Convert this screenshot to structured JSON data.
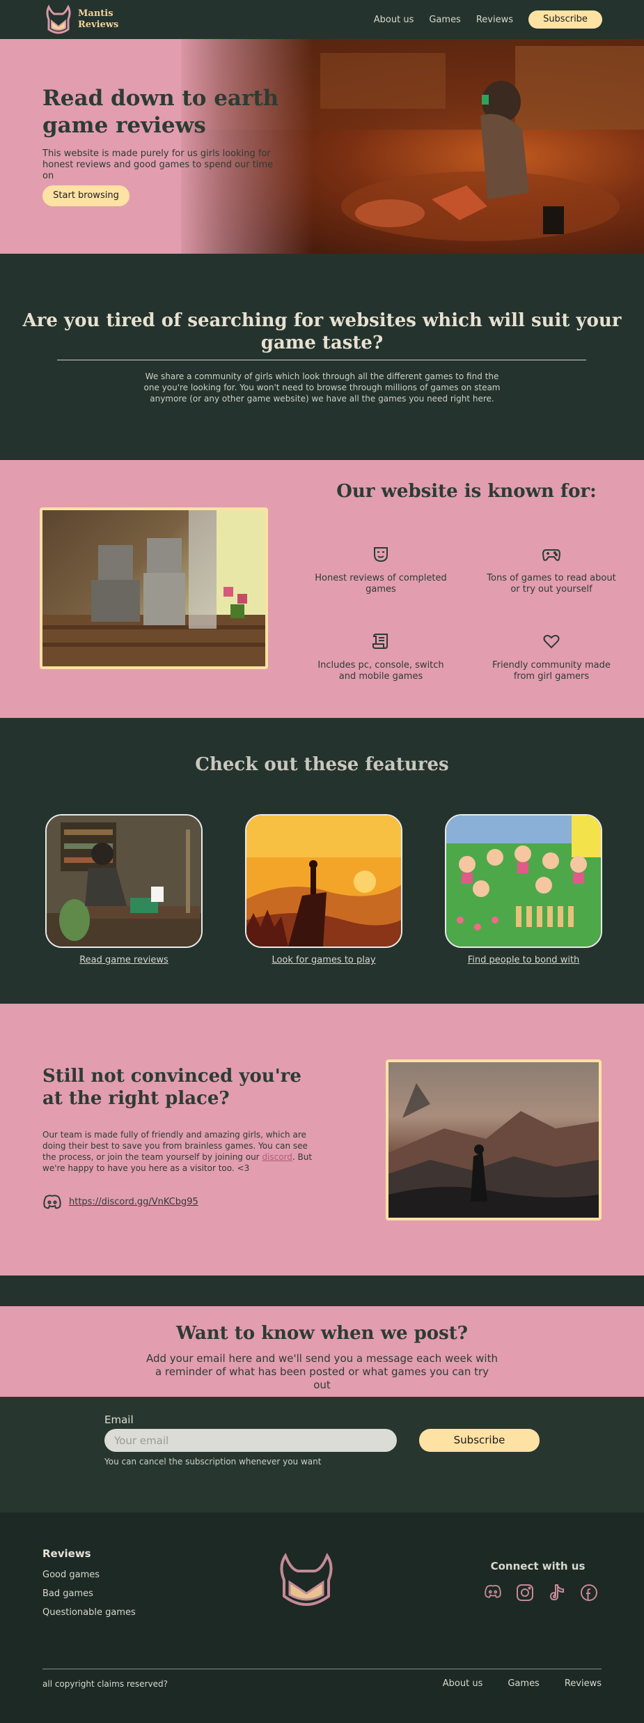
{
  "brand": {
    "line1": "Mantis",
    "line2": "Reviews",
    "logo_icon": "mantis-logo-icon"
  },
  "nav": {
    "about": "About us",
    "games": "Games",
    "reviews": "Reviews",
    "subscribe": "Subscribe"
  },
  "hero": {
    "title": "Read down to earth game reviews",
    "subtitle": "This website is made purely for us girls looking for honest reviews and good games to spend our time on",
    "cta": "Start browsing"
  },
  "tired": {
    "title": "Are you tired of searching for websites which will suit your game taste?",
    "body": "We share a community of girls which look through all the different games to find the one you're looking for. You won't need to browse through millions of games on steam anymore (or any other game website) we have all the games you need right here."
  },
  "known": {
    "title": "Our website is known for:",
    "items": [
      {
        "icon": "mask-icon",
        "label": "Honest reviews of completed games"
      },
      {
        "icon": "gamepad-icon",
        "label": "Tons of games to read about or try out yourself"
      },
      {
        "icon": "scroll-icon",
        "label": "Includes pc, console, switch and mobile games"
      },
      {
        "icon": "heart-icon",
        "label": "Friendly community made from girl gamers"
      }
    ]
  },
  "features": {
    "title": "Check out these features",
    "cards": [
      {
        "label": "Read game reviews"
      },
      {
        "label": "Look for games to play"
      },
      {
        "label": "Find people to bond with"
      }
    ]
  },
  "convinced": {
    "title": "Still not convinced you're at the right place?",
    "body_before": "Our team is made fully of friendly and amazing girls, which are doing their best to save you from brainless games. You can see the process, or join the team yourself by joining our ",
    "body_link": "discord",
    "body_after": ". But we're happy to have you here as a visitor too. <3",
    "discord_url": "https://discord.gg/VnKCbg95",
    "discord_icon": "discord-icon"
  },
  "newsletter": {
    "title": "Want to know when we post?",
    "body": "Add your email here and we'll send you a message each week with a reminder of what has been posted or what games you can try out",
    "email_label": "Email",
    "email_placeholder": "Your email",
    "email_value": "",
    "button": "Subscribe",
    "note": "You can cancel the subscription whenever you want"
  },
  "footer": {
    "reviews_heading": "Reviews",
    "links": [
      "Good games",
      "Bad games",
      "Questionable games"
    ],
    "connect": "Connect with us",
    "socials": [
      "discord-icon",
      "instagram-icon",
      "tiktok-icon",
      "facebook-icon"
    ],
    "copyright": "all copyright claims reserved?",
    "bottom_nav": [
      "About us",
      "Games",
      "Reviews"
    ]
  },
  "colors": {
    "pink": "#e29dae",
    "dark_green": "#24332d",
    "cream": "#fde2a4",
    "text_dark": "#2c3c33"
  }
}
